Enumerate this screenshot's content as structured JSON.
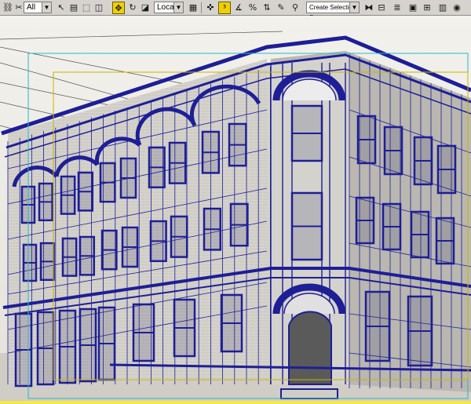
{
  "toolbar": {
    "selection_filter": "All",
    "reference_coord": "Local",
    "named_selection_placeholder": "Create Selection Set",
    "icons": [
      "link-icon",
      "unlink-icon",
      "select-object-icon",
      "select-by-name-icon",
      "rectangle-region-icon",
      "window-crossing-icon",
      "select-move-icon",
      "select-rotate-icon",
      "select-scale-icon",
      "pivot-icon",
      "manipulate-icon",
      "snap-3d-icon",
      "angle-snap-icon",
      "percent-snap-icon",
      "spinner-snap-icon",
      "edit-named-sets-icon",
      "mirror-icon",
      "align-icon",
      "layer-manager-icon",
      "curve-editor-icon",
      "schematic-view-icon",
      "material-editor-icon",
      "render-setup-icon",
      "render-icon"
    ]
  },
  "viewport": {
    "name": "perspective-viewport",
    "wire_color": "#1e1e96",
    "frame_color": "#2ab8c8",
    "safe_frame_color": "#c8b400"
  }
}
